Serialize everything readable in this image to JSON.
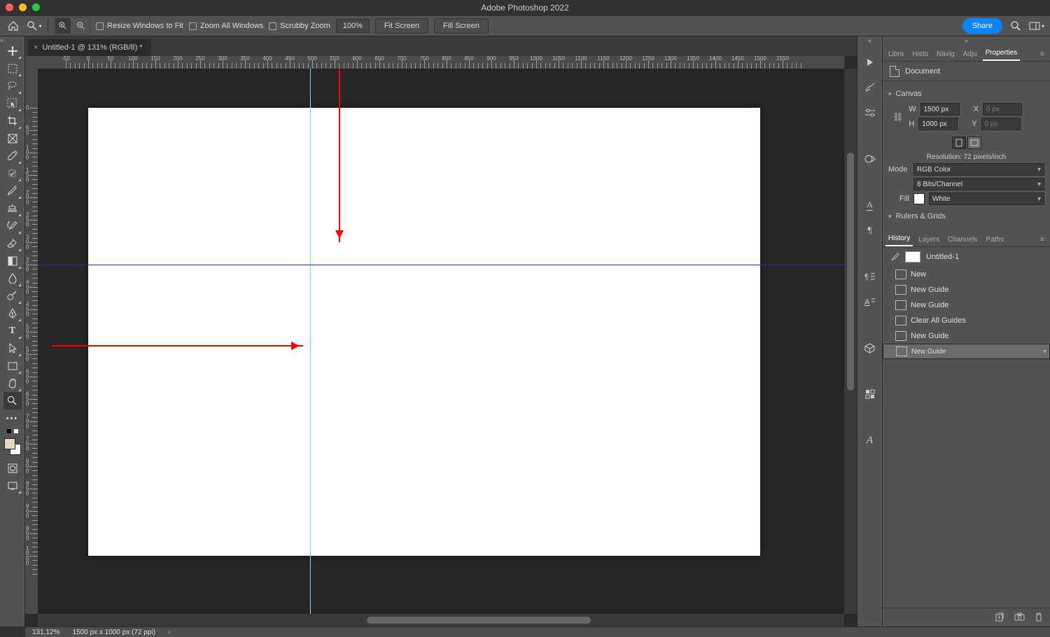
{
  "app_title": "Adobe Photoshop 2022",
  "options_bar": {
    "resize_windows": "Resize Windows to Fit",
    "zoom_all": "Zoom All Windows",
    "scrubby": "Scrubby Zoom",
    "zoom_value": "100%",
    "fit_screen": "Fit Screen",
    "fill_screen": "Fill Screen",
    "share": "Share"
  },
  "document": {
    "tab_title": "Untitled-1 @ 131% (RGB/8) *",
    "zoom_display": "131,12%",
    "dimensions_display": "1500 px x 1000 px (72 ppi)"
  },
  "ruler_h_labels": [
    "-50",
    "0",
    "50",
    "100",
    "150",
    "200",
    "250",
    "300",
    "350",
    "400",
    "450",
    "500",
    "550",
    "600",
    "650",
    "700",
    "750",
    "800",
    "850",
    "900",
    "950",
    "1000",
    "1050",
    "1100",
    "1150",
    "1200",
    "1250",
    "1300",
    "1350",
    "1400",
    "1450",
    "1500",
    "1550"
  ],
  "ruler_v_labels": [
    "0",
    "50",
    "100",
    "150",
    "200",
    "250",
    "300",
    "350",
    "400",
    "450",
    "500",
    "550",
    "600",
    "650",
    "700",
    "750",
    "800",
    "850",
    "900",
    "950",
    "1000"
  ],
  "properties": {
    "tabs": [
      "Libra",
      "Histo",
      "Navig",
      "Adju",
      "Properties"
    ],
    "doc_label": "Document",
    "canvas_label": "Canvas",
    "w_label": "W",
    "w_value": "1500 px",
    "h_label": "H",
    "h_value": "1000 px",
    "x_label": "X",
    "x_value": "0 px",
    "y_label": "Y",
    "y_value": "0 px",
    "resolution": "Resolution: 72 pixels/inch",
    "mode_label": "Mode",
    "mode_value": "RGB Color",
    "bits_value": "8 Bits/Channel",
    "fill_label": "Fill",
    "fill_value": "White",
    "rulers_label": "Rulers & Grids"
  },
  "history": {
    "tabs": [
      "History",
      "Layers",
      "Channels",
      "Paths"
    ],
    "doc_name": "Untitled-1",
    "items": [
      "New",
      "New Guide",
      "New Guide",
      "Clear All Guides",
      "New Guide",
      "New Guide"
    ]
  }
}
